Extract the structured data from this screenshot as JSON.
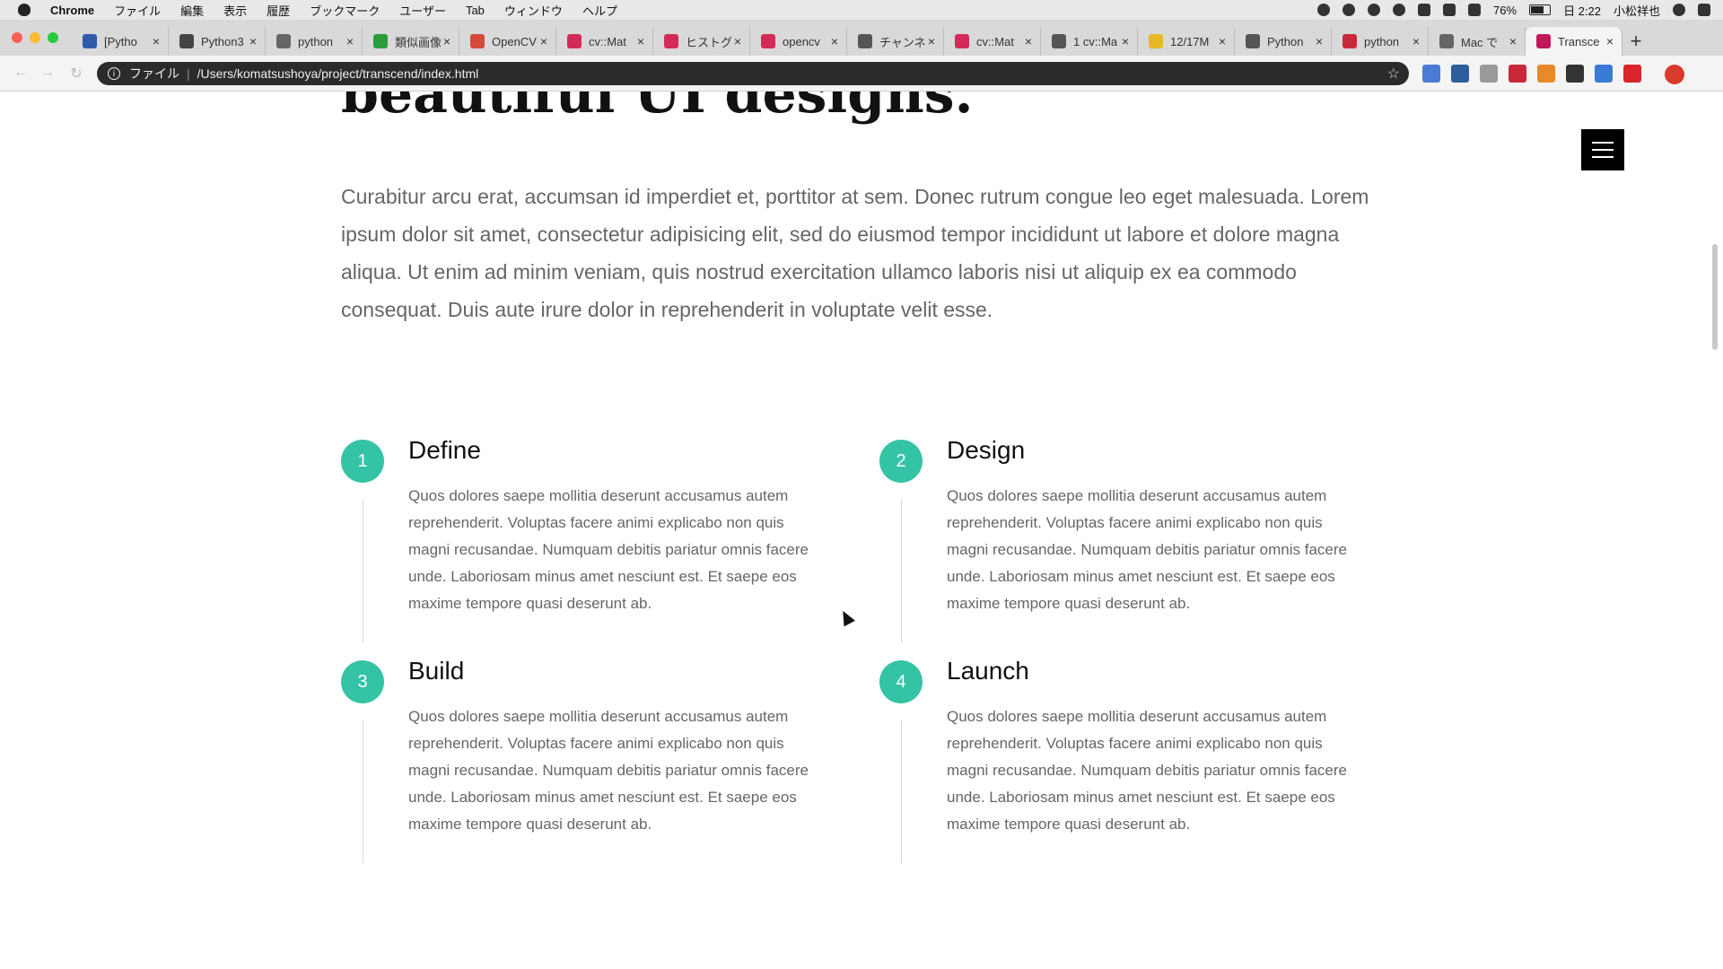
{
  "menubar": {
    "app": "Chrome",
    "items": [
      "ファイル",
      "編集",
      "表示",
      "履歴",
      "ブックマーク",
      "ユーザー",
      "Tab",
      "ウィンドウ",
      "ヘルプ"
    ],
    "battery": "76%",
    "time": "日 2:22",
    "user": "小松祥也"
  },
  "tabs": [
    {
      "title": "[Pytho",
      "color": "#2e5aac"
    },
    {
      "title": "Python3",
      "color": "#444444"
    },
    {
      "title": "python",
      "color": "#666666"
    },
    {
      "title": "類似画像",
      "color": "#2a9d3a"
    },
    {
      "title": "OpenCV",
      "color": "#d44a3a"
    },
    {
      "title": "cv::Mat",
      "color": "#d42a5a"
    },
    {
      "title": "ヒストグ",
      "color": "#d42a5a"
    },
    {
      "title": "opencv",
      "color": "#d42a5a"
    },
    {
      "title": "チャンネ",
      "color": "#555555"
    },
    {
      "title": "cv::Mat",
      "color": "#d42a5a"
    },
    {
      "title": "1 cv::Ma",
      "color": "#555555"
    },
    {
      "title": "12/17M",
      "color": "#e8b82a"
    },
    {
      "title": "Python",
      "color": "#555555"
    },
    {
      "title": "python",
      "color": "#c8283a"
    },
    {
      "title": "Mac で",
      "color": "#666666"
    },
    {
      "title": "Transce",
      "color": "#c2185b"
    }
  ],
  "toolbar": {
    "scheme": "ファイル",
    "url": "/Users/komatsushoya/project/transcend/index.html"
  },
  "page": {
    "heading": "beautiful UI designs.",
    "intro": "Curabitur arcu erat, accumsan id imperdiet et, porttitor at sem. Donec rutrum congue leo eget malesuada. Lorem ipsum dolor sit amet, consectetur adipisicing elit, sed do eiusmod tempor incididunt ut labore et dolore magna aliqua. Ut enim ad minim veniam, quis nostrud exercitation ullamco laboris nisi ut aliquip ex ea commodo consequat. Duis aute irure dolor in reprehenderit in voluptate velit esse.",
    "steps": [
      {
        "num": "1",
        "title": "Define",
        "text": "Quos dolores saepe mollitia deserunt accusamus autem reprehenderit. Voluptas facere animi explicabo non quis magni recusandae. Numquam debitis pariatur omnis facere unde. Laboriosam minus amet nesciunt est. Et saepe eos maxime tempore quasi deserunt ab."
      },
      {
        "num": "2",
        "title": "Design",
        "text": "Quos dolores saepe mollitia deserunt accusamus autem reprehenderit. Voluptas facere animi explicabo non quis magni recusandae. Numquam debitis pariatur omnis facere unde. Laboriosam minus amet nesciunt est. Et saepe eos maxime tempore quasi deserunt ab."
      },
      {
        "num": "3",
        "title": "Build",
        "text": "Quos dolores saepe mollitia deserunt accusamus autem reprehenderit. Voluptas facere animi explicabo non quis magni recusandae. Numquam debitis pariatur omnis facere unde. Laboriosam minus amet nesciunt est. Et saepe eos maxime tempore quasi deserunt ab."
      },
      {
        "num": "4",
        "title": "Launch",
        "text": "Quos dolores saepe mollitia deserunt accusamus autem reprehenderit. Voluptas facere animi explicabo non quis magni recusandae. Numquam debitis pariatur omnis facere unde. Laboriosam minus amet nesciunt est. Et saepe eos maxime tempore quasi deserunt ab."
      }
    ]
  },
  "colors": {
    "accent": "#35c3a5",
    "hamburger": "#000000",
    "omnibox": "#2b2b2b"
  }
}
